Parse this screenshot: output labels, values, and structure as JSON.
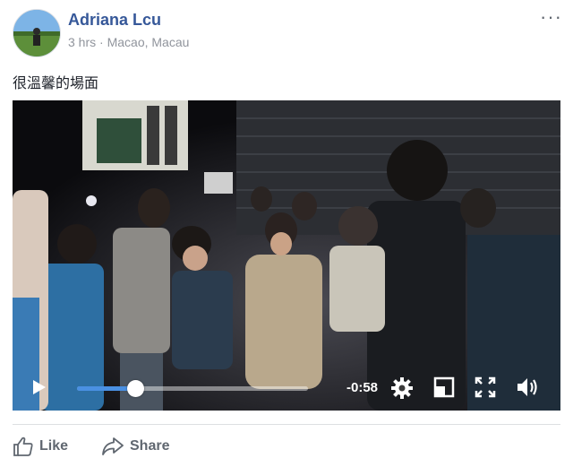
{
  "post": {
    "author": "Adriana Lcu",
    "time": "3 hrs",
    "separator": "·",
    "location": "Macao, Macau",
    "more_icon": "more-horizontal-icon",
    "text": "很溫馨的場面"
  },
  "video": {
    "time_remaining": "-0:58",
    "progress": 0.25,
    "controls": [
      "play-icon",
      "settings-gear-icon",
      "minimize-icon",
      "fullscreen-icon",
      "volume-icon"
    ],
    "accent_color": "#4a90e2"
  },
  "actions": {
    "like": "Like",
    "share": "Share"
  }
}
